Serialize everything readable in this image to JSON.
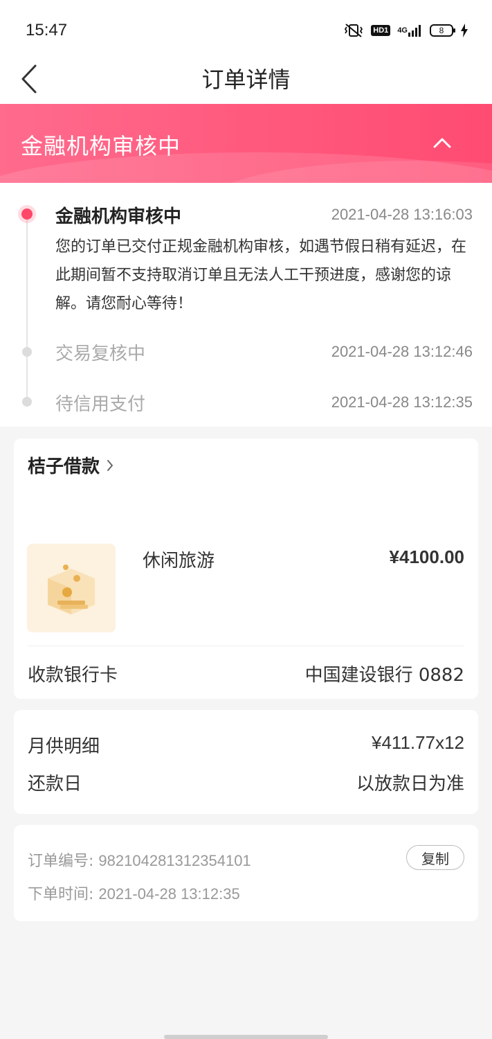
{
  "status_bar": {
    "time": "15:47",
    "hd_label": "HD1",
    "network_label": "4G",
    "battery": "8",
    "icons": [
      "vibrate-icon",
      "hd-icon",
      "signal-icon",
      "battery-icon",
      "charging-icon"
    ]
  },
  "nav": {
    "title": "订单详情",
    "back_icon": "chevron-left-icon"
  },
  "banner": {
    "title": "金融机构审核中",
    "toggle_icon": "chevron-up-icon"
  },
  "timeline": [
    {
      "title": "金融机构审核中",
      "time": "2021-04-28 13:16:03",
      "description": "您的订单已交付正规金融机构审核，如遇节假日稍有延迟，在此期间暂不支持取消订单且无法人工干预进度，感谢您的谅解。请您耐心等待！",
      "active": true
    },
    {
      "title": "交易复核中",
      "time": "2021-04-28 13:12:46",
      "active": false
    },
    {
      "title": "待信用支付",
      "time": "2021-04-28 13:12:35",
      "active": false
    }
  ],
  "product_card": {
    "merchant": "桔子借款",
    "merchant_icon": "chevron-right-icon",
    "product_name": "休闲旅游",
    "product_price": "¥4100.00",
    "bank_label": "收款银行卡",
    "bank_value": "中国建设银行 0882"
  },
  "repay_card": {
    "monthly_label": "月供明细",
    "monthly_value": "¥411.77x12",
    "due_label": "还款日",
    "due_value": "以放款日为准"
  },
  "order_card": {
    "order_no_label": "订单编号:",
    "order_no": "982104281312354101",
    "order_time_label": "下单时间:",
    "order_time": "2021-04-28 13:12:35",
    "copy_label": "复制"
  },
  "colors": {
    "accent": "#ff4769",
    "banner_start": "#ff6b8d",
    "banner_end": "#ff4b72"
  }
}
